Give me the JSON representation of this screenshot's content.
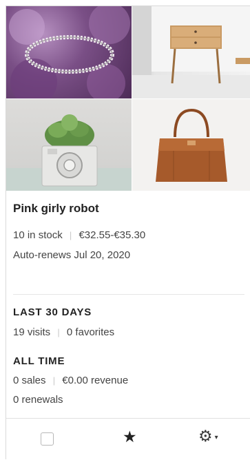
{
  "listing": {
    "title": "Pink girly robot",
    "stock": "10 in stock",
    "price_range": "€32.55-€35.30",
    "renewal": "Auto-renews Jul 20, 2020"
  },
  "stats": {
    "last30": {
      "heading": "LAST 30 DAYS",
      "visits": "19 visits",
      "favorites": "0 favorites"
    },
    "alltime": {
      "heading": "ALL TIME",
      "sales": "0 sales",
      "revenue": "€0.00 revenue",
      "renewals": "0 renewals"
    }
  },
  "images": [
    {
      "name": "ring-image",
      "icon": "ring"
    },
    {
      "name": "nightstand-image",
      "icon": "nightstand"
    },
    {
      "name": "succulent-planter-image",
      "icon": "succulent-camera-planter"
    },
    {
      "name": "leather-bag-image",
      "icon": "leather-bag"
    }
  ],
  "footer": {
    "checkbox_checked": false,
    "star_glyph": "★",
    "gear_glyph": "⚙",
    "caret_glyph": "▾"
  },
  "colors": {
    "text": "#222222",
    "muted": "#444444",
    "divider": "#e6e6e6",
    "border": "#d9d9d9"
  }
}
